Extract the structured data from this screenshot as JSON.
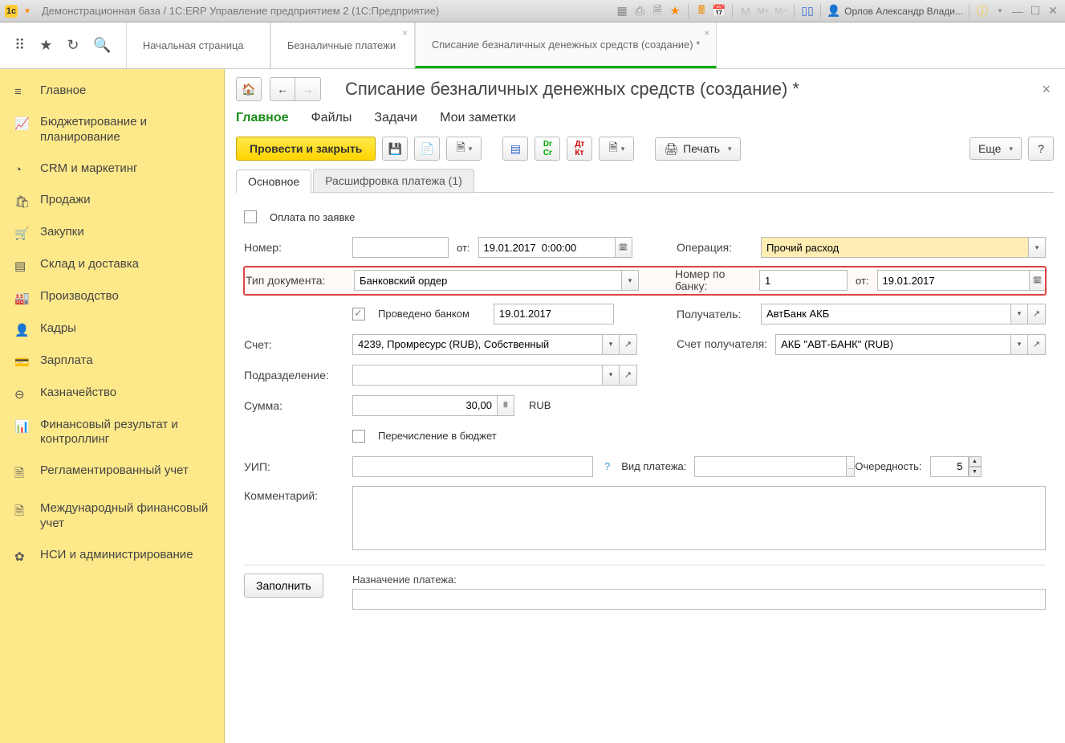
{
  "titlebar": {
    "title": "Демонстрационная база / 1С:ERP Управление предприятием 2  (1С:Предприятие)",
    "user": "Орлов Александр Влади..."
  },
  "topnav_tabs": [
    {
      "label": "Начальная страница",
      "closable": false
    },
    {
      "label": "Безналичные платежи",
      "closable": true
    },
    {
      "label": "Списание безналичных денежных средств (создание) *",
      "closable": true
    }
  ],
  "sidebar": {
    "items": [
      {
        "icon": "≡",
        "label": "Главное"
      },
      {
        "icon": "📈",
        "label": "Бюджетирование и планирование"
      },
      {
        "icon": "◔",
        "label": "CRM и маркетинг"
      },
      {
        "icon": "🛍",
        "label": "Продажи"
      },
      {
        "icon": "🛒",
        "label": "Закупки"
      },
      {
        "icon": "▤",
        "label": "Склад и доставка"
      },
      {
        "icon": "🏭",
        "label": "Производство"
      },
      {
        "icon": "👤",
        "label": "Кадры"
      },
      {
        "icon": "💳",
        "label": "Зарплата"
      },
      {
        "icon": "⊖",
        "label": "Казначейство"
      },
      {
        "icon": "📊",
        "label": "Финансовый результат и контроллинг"
      },
      {
        "icon": "🗎",
        "label": "Регламентированный учет"
      },
      {
        "icon": "🗎",
        "label": "Международный финансовый учет"
      },
      {
        "icon": "✿",
        "label": "НСИ и администрирование"
      }
    ]
  },
  "document": {
    "title": "Списание безналичных денежных средств (создание) *",
    "nav": [
      "Главное",
      "Файлы",
      "Задачи",
      "Мои заметки"
    ],
    "toolbar": {
      "main_button": "Провести и закрыть",
      "print": "Печать",
      "more": "Еще",
      "help": "?"
    },
    "subtabs": [
      "Основное",
      "Расшифровка платежа (1)"
    ],
    "form": {
      "pay_by_request_label": "Оплата по заявке",
      "number_label": "Номер:",
      "number_value": "",
      "from_label": "от:",
      "date_value": "19.01.2017  0:00:00",
      "operation_label": "Операция:",
      "operation_value": "Прочий расход",
      "doctype_label": "Тип документа:",
      "doctype_value": "Банковский ордер",
      "bank_number_label": "Номер по банку:",
      "bank_number_value": "1",
      "bank_from_label": "от:",
      "bank_date_value": "19.01.2017",
      "bank_processed_label": "Проведено банком",
      "bank_processed_date": "19.01.2017",
      "recipient_label": "Получатель:",
      "recipient_value": "АвтБанк АКБ",
      "account_label": "Счет:",
      "account_value": "4239, Промресурс (RUB), Собственный",
      "recipient_acc_label": "Счет получателя:",
      "recipient_acc_value": "АКБ \"АВТ-БАНК\" (RUB)",
      "division_label": "Подразделение:",
      "division_value": "",
      "sum_label": "Сумма:",
      "sum_value": "30,00",
      "currency": "RUB",
      "budget_transfer_label": "Перечисление в бюджет",
      "uip_label": "УИП:",
      "uip_value": "",
      "payment_kind_label": "Вид платежа:",
      "payment_kind_value": "",
      "priority_label": "Очередность:",
      "priority_value": "5",
      "comment_label": "Комментарий:",
      "comment_value": "",
      "purpose_label": "Назначение платежа:",
      "fill_button": "Заполнить"
    }
  }
}
